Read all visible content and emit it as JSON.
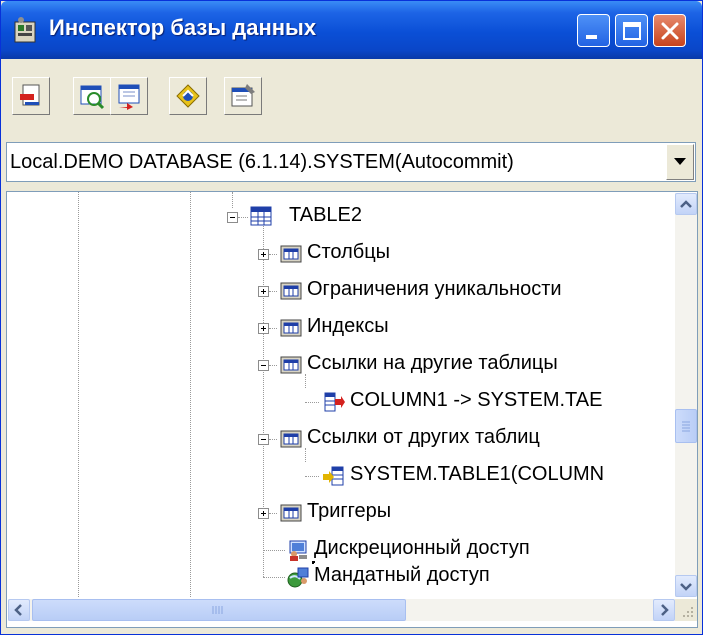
{
  "window": {
    "title": "Инспектор базы данных"
  },
  "connection": {
    "selected": "Local.DEMO DATABASE (6.1.14).SYSTEM(Autocommit)"
  },
  "toolbar": {
    "tools": [
      "refresh-icon",
      "table-filter-icon",
      "table-arrow-icon",
      "sync-icon",
      "properties-icon"
    ]
  },
  "tree": {
    "nodes": [
      {
        "label": "TABLE2",
        "icon": "table-icon",
        "expander": "minus"
      },
      {
        "label": "Столбцы",
        "icon": "folder-icon",
        "expander": "plus"
      },
      {
        "label": "Ограничения уникальности",
        "icon": "folder-icon",
        "expander": "plus"
      },
      {
        "label": "Индексы",
        "icon": "folder-icon",
        "expander": "plus"
      },
      {
        "label": "Ссылки на другие таблицы",
        "icon": "folder-icon",
        "expander": "minus"
      },
      {
        "label": "COLUMN1 -> SYSTEM.TAE",
        "icon": "foreign-key-icon",
        "expander": "none"
      },
      {
        "label": "Ссылки от других таблиц",
        "icon": "folder-icon",
        "expander": "minus"
      },
      {
        "label": "SYSTEM.TABLE1(COLUMN",
        "icon": "reference-icon",
        "expander": "none"
      },
      {
        "label": "Триггеры",
        "icon": "folder-icon",
        "expander": "plus"
      },
      {
        "label": "Дискреционный доступ",
        "icon": "discretionary-access-icon",
        "expander": "none"
      },
      {
        "label": "Мандатный доступ",
        "icon": "mandatory-access-icon",
        "expander": "none"
      }
    ]
  },
  "colors": {
    "titlebar": "#0a4fd6",
    "close": "#c8431c",
    "scrollbar": "#c2d3f7"
  }
}
